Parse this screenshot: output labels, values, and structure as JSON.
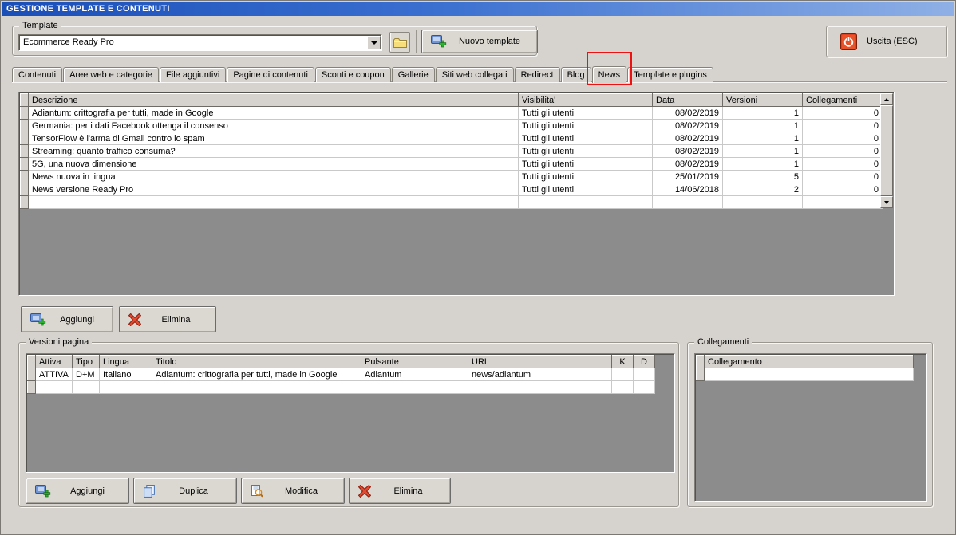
{
  "window": {
    "title": "GESTIONE TEMPLATE E CONTENUTI"
  },
  "template_section": {
    "label": "Template",
    "selected_template": "Ecommerce Ready Pro",
    "new_template_label": "Nuovo template"
  },
  "exit": {
    "label": "Uscita (ESC)"
  },
  "tabs": [
    "Contenuti",
    "Aree web e categorie",
    "File aggiuntivi",
    "Pagine di contenuti",
    "Sconti e coupon",
    "Gallerie",
    "Siti web collegati",
    "Redirect",
    "Blog",
    "News",
    "Template e plugins"
  ],
  "active_tab": "News",
  "annotation": {
    "shape": "red-rectangle",
    "target": "News tab",
    "color": "#ee1111"
  },
  "news_table": {
    "columns": [
      "Descrizione",
      "Visibilita'",
      "Data",
      "Versioni",
      "Collegamenti"
    ],
    "rows": [
      [
        "Adiantum: crittografia per tutti, made in Google",
        "Tutti gli utenti",
        "08/02/2019",
        "1",
        "0"
      ],
      [
        "Germania: per i dati Facebook ottenga il consenso",
        "Tutti gli utenti",
        "08/02/2019",
        "1",
        "0"
      ],
      [
        "TensorFlow è l'arma di Gmail contro lo spam",
        "Tutti gli utenti",
        "08/02/2019",
        "1",
        "0"
      ],
      [
        "Streaming: quanto traffico consuma?",
        "Tutti gli utenti",
        "08/02/2019",
        "1",
        "0"
      ],
      [
        "5G, una nuova dimensione",
        "Tutti gli utenti",
        "08/02/2019",
        "1",
        "0"
      ],
      [
        "News nuova in lingua",
        "Tutti gli utenti",
        "25/01/2019",
        "5",
        "0"
      ],
      [
        "News versione Ready Pro",
        "Tutti gli utenti",
        "14/06/2018",
        "2",
        "0"
      ]
    ]
  },
  "news_actions": {
    "add": "Aggiungi",
    "delete": "Elimina"
  },
  "versions_section": {
    "title": "Versioni pagina",
    "columns": [
      "Attiva",
      "Tipo",
      "Lingua",
      "Titolo",
      "Pulsante",
      "URL",
      "K",
      "D"
    ],
    "rows": [
      [
        "ATTIVA",
        "D+M",
        "Italiano",
        "Adiantum: crittografia per tutti, made in Google",
        "Adiantum",
        "news/adiantum",
        "",
        ""
      ]
    ],
    "buttons": {
      "add": "Aggiungi",
      "duplicate": "Duplica",
      "edit": "Modifica",
      "delete": "Elimina"
    }
  },
  "links_section": {
    "title": "Collegamenti",
    "columns": [
      "Collegamento"
    ]
  }
}
